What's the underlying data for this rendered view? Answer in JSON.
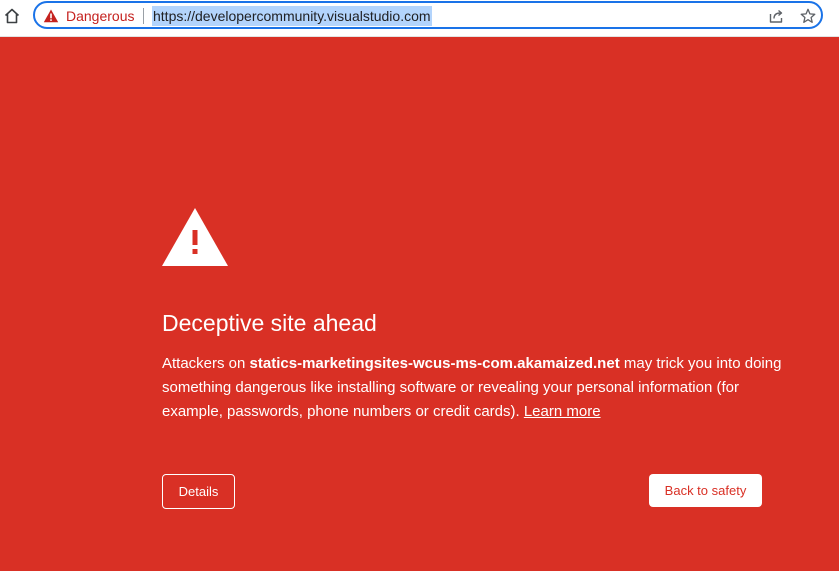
{
  "browser": {
    "security_chip": {
      "label": "Dangerous",
      "icon": "warning-triangle-icon"
    },
    "url": "https://developercommunity.visualstudio.com",
    "icons": {
      "home": "home-icon",
      "share": "share-icon",
      "bookmark": "star-icon"
    }
  },
  "interstitial": {
    "heading": "Deceptive site ahead",
    "message": {
      "prefix": "Attackers on ",
      "domain": "statics-marketingsites-wcus-ms-com.akamaized.net",
      "suffix": " may trick you into doing something dangerous like installing software or revealing your personal information (for example, passwords, phone numbers or credit cards). ",
      "learn_more": "Learn more"
    },
    "details_button": "Details",
    "safety_button": "Back to safety"
  },
  "colors": {
    "danger_red": "#d93025",
    "chip_red": "#c5221f",
    "omnibox_focus": "#1a73e8",
    "selection": "#b3d4fc",
    "white": "#ffffff"
  }
}
